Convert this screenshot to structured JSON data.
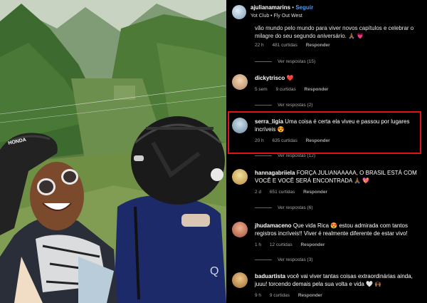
{
  "header": {
    "username": "ajulianamarins",
    "dot": "•",
    "follow_label": "Seguir",
    "subtitle": "Yot Club • Fly Out West"
  },
  "comments": [
    {
      "text": "vão mundo pelo mundo para viver novos capítulos e celebrar o milagre do seu segundo aniversário. 🙏🏾 💗",
      "time": "22 h",
      "likes": "481 curtidas",
      "reply_label": "Responder",
      "view_replies": "Ver respostas (15)"
    },
    {
      "username": "dickytrisco",
      "text": "❤️",
      "time": "5 sem",
      "likes": "9 curtidas",
      "reply_label": "Responder",
      "view_replies": "Ver respostas (2)"
    },
    {
      "username": "serra_ligia",
      "text": "Uma coisa é certa ela viveu e passou por lugares incríveis 😍",
      "time": "20 h",
      "likes": "635 curtidas",
      "reply_label": "Responder",
      "view_replies": "Ver respostas (12)"
    },
    {
      "username": "hannagabriiela",
      "text": "FORÇA JULIANAAAAA, O BRASIL ESTÁ COM VOCÊ E VOCÊ SERÁ ENCONTRADA 🙏🏾 💖",
      "time": "2 d",
      "likes": "651 curtidas",
      "reply_label": "Responder",
      "view_replies": "Ver respostas (6)"
    },
    {
      "username": "jhudamaceno",
      "text": "Que vida Rica 😍 estou admirada com tantos registros incríveis!! Viver é realmente diferente de estar vivo!",
      "time": "1 h",
      "likes": "12 curtidas",
      "reply_label": "Responder",
      "view_replies": "Ver respostas (3)"
    },
    {
      "username": "baduartista",
      "text": "você vai viver tantas coisas extraordinárias ainda, juuu! torcendo demais pela sua volta e vida 🤍 🙌🏾",
      "time": "9 h",
      "likes": "9 curtidas",
      "reply_label": "Responder"
    }
  ],
  "colors": {
    "follow": "#4a9cf5",
    "highlight_border": "#e0101f",
    "meta_text": "#a8a8a8"
  },
  "photo": {
    "helmet_left_brand": "HONDA",
    "jacket_letter": "Q"
  }
}
